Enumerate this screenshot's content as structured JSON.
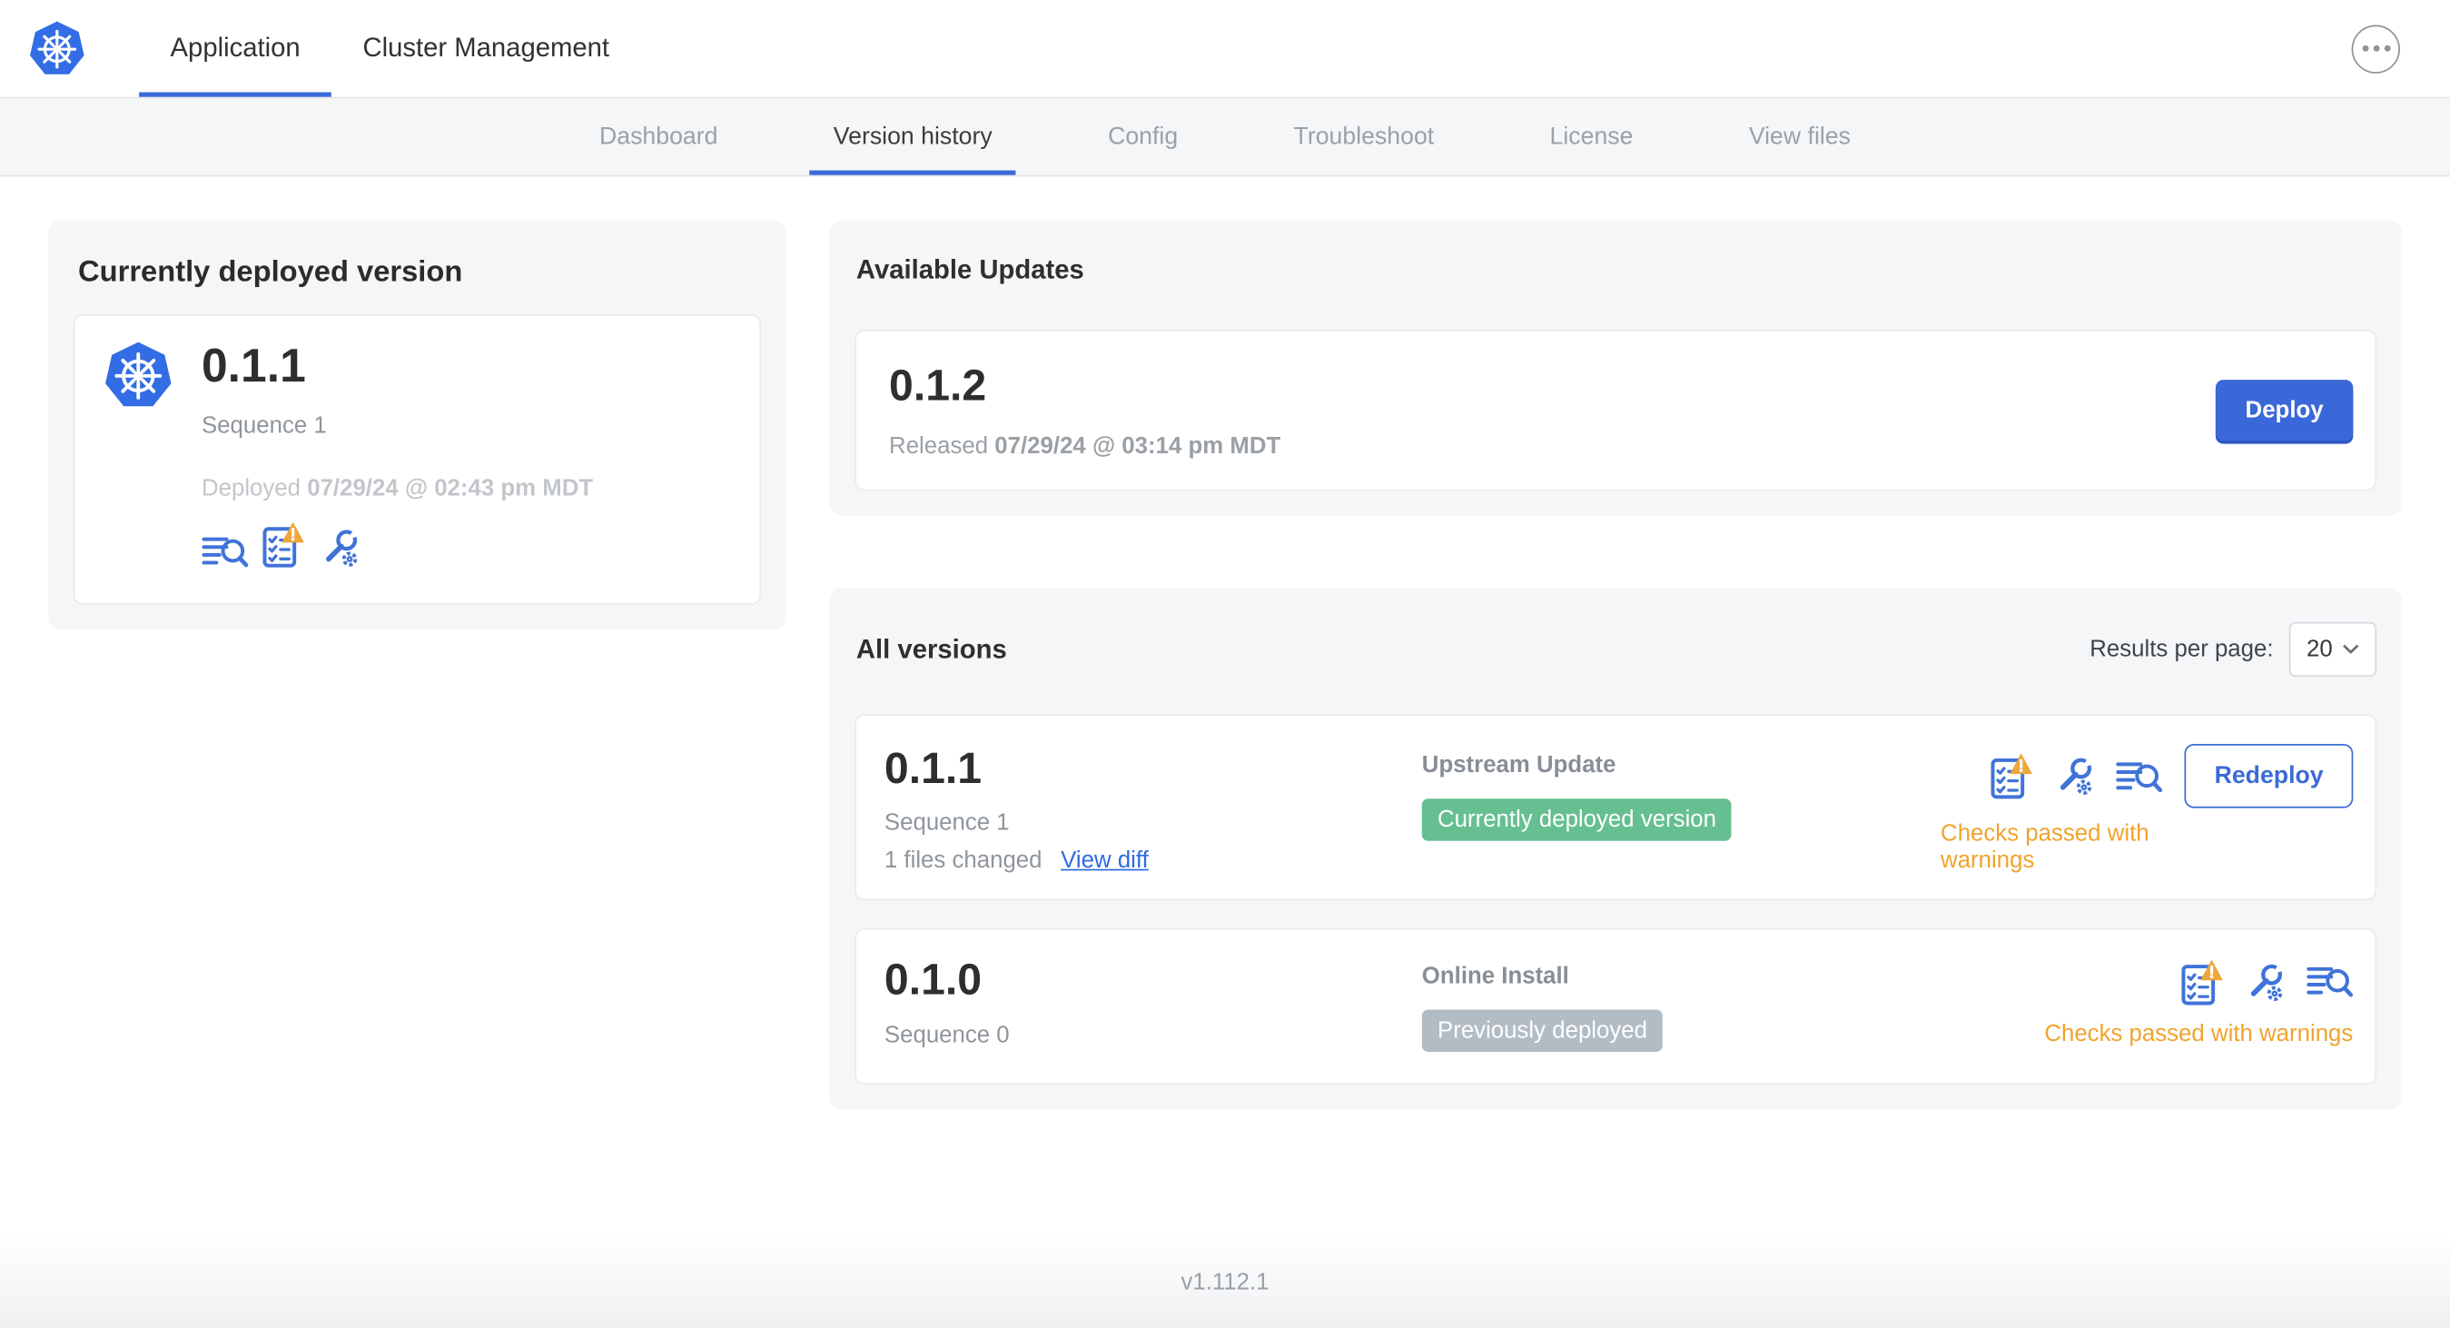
{
  "topnav": {
    "tabs": [
      {
        "label": "Application"
      },
      {
        "label": "Cluster Management"
      }
    ]
  },
  "subnav": {
    "tabs": [
      {
        "label": "Dashboard"
      },
      {
        "label": "Version history"
      },
      {
        "label": "Config"
      },
      {
        "label": "Troubleshoot"
      },
      {
        "label": "License"
      },
      {
        "label": "View files"
      }
    ]
  },
  "deployed_card": {
    "title": "Currently deployed version",
    "version": "0.1.1",
    "sequence": "Sequence 1",
    "deployed_prefix": "Deployed",
    "deployed_date": "07/29/24 @ 02:43 pm MDT"
  },
  "available_updates": {
    "title": "Available Updates",
    "version": "0.1.2",
    "released_prefix": "Released",
    "released_date": "07/29/24 @ 03:14 pm MDT",
    "deploy_label": "Deploy"
  },
  "all_versions": {
    "title": "All versions",
    "results_per_page_label": "Results per page:",
    "results_per_page_value": "20",
    "rows": [
      {
        "version": "0.1.1",
        "sequence": "Sequence 1",
        "files_changed": "1 files changed",
        "view_diff_label": "View diff",
        "source": "Upstream Update",
        "badge": "Currently deployed version",
        "status": "Checks passed with warnings",
        "action_label": "Redeploy"
      },
      {
        "version": "0.1.0",
        "sequence": "Sequence 0",
        "source": "Online Install",
        "badge": "Previously deployed",
        "status": "Checks passed with warnings"
      }
    ]
  },
  "footer": {
    "app_version": "v1.112.1"
  },
  "colors": {
    "kubernetes_blue": "#326de6",
    "accent_blue": "#3b6bd6",
    "link_blue": "#2d6be0",
    "icon_blue": "#4073d8",
    "badge_green": "#66bf90",
    "badge_gray": "#b2bcc5",
    "warning_orange": "#f0a32c",
    "card_gray": "#f5f6f8"
  }
}
